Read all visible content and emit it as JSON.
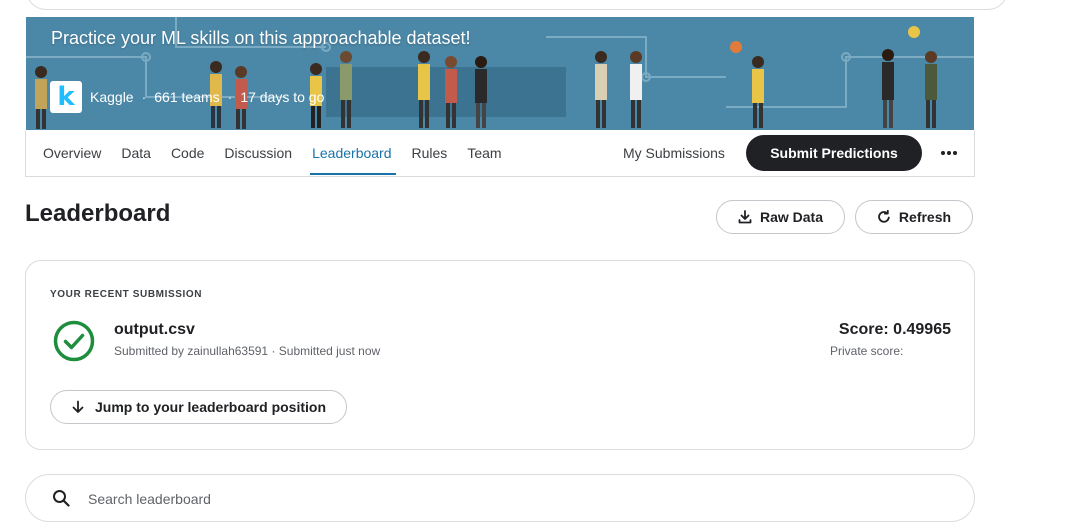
{
  "banner": {
    "subtitle": "Practice your ML skills on this approachable dataset!",
    "logo_letter": "k",
    "host": "Kaggle",
    "teams": "661 teams",
    "deadline": "17 days to go",
    "separator": "·",
    "background_color": "#4b87a6"
  },
  "nav": {
    "tabs": [
      {
        "label": "Overview",
        "active": false
      },
      {
        "label": "Data",
        "active": false
      },
      {
        "label": "Code",
        "active": false
      },
      {
        "label": "Discussion",
        "active": false
      },
      {
        "label": "Leaderboard",
        "active": true
      },
      {
        "label": "Rules",
        "active": false
      },
      {
        "label": "Team",
        "active": false
      }
    ],
    "my_submissions": "My Submissions",
    "submit_button": "Submit Predictions",
    "more_icon": "more-horizontal-icon",
    "accent_color": "#1a73a8"
  },
  "leaderboard": {
    "title": "Leaderboard",
    "raw_data_button": "Raw Data",
    "raw_data_icon": "download-icon",
    "refresh_button": "Refresh",
    "refresh_icon": "refresh-icon"
  },
  "recent_submission": {
    "label": "YOUR RECENT SUBMISSION",
    "status_icon": "check-circle-icon",
    "status_color": "#1e8e3e",
    "file_name": "output.csv",
    "submitted_info": "Submitted by zainullah63591 · Submitted just now",
    "score": "Score: 0.49965",
    "private_score": "Private score:",
    "jump_button": "Jump to your leaderboard position",
    "jump_icon": "arrow-down-icon"
  },
  "search": {
    "placeholder": "Search leaderboard",
    "icon": "search-icon"
  }
}
